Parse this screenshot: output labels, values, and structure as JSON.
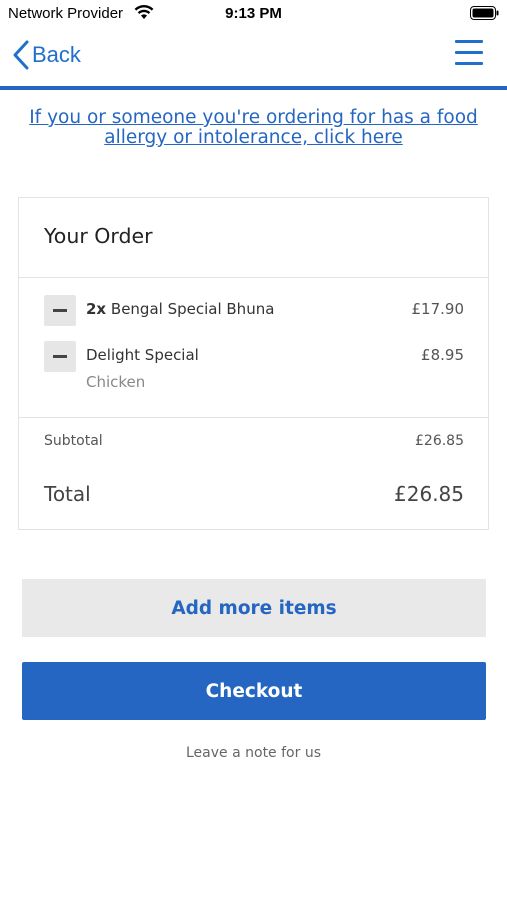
{
  "status_bar": {
    "carrier": "Network Provider",
    "time": "9:13 PM",
    "wifi_icon": "wifi-icon",
    "battery_icon": "battery-icon"
  },
  "nav": {
    "back_label": "Back",
    "menu_icon": "hamburger-menu-icon",
    "accent_color": "#1f6fcb"
  },
  "allergy_notice": "If you or someone you're ordering for has a food allergy or intolerance, click here",
  "order": {
    "title": "Your Order",
    "items": [
      {
        "qty": "2x",
        "name": "Bengal Special Bhuna",
        "price": "£17.90",
        "option": ""
      },
      {
        "qty": "",
        "name": "Delight Special",
        "price": "£8.95",
        "option": "Chicken"
      }
    ],
    "subtotal_label": "Subtotal",
    "subtotal_value": "£26.85",
    "total_label": "Total",
    "total_value": "£26.85"
  },
  "actions": {
    "add_more_label": "Add more items",
    "checkout_label": "Checkout",
    "note_label": "Leave a note for us"
  },
  "colors": {
    "primary": "#2466c1",
    "secondary_button_bg": "#e9e9e9"
  }
}
